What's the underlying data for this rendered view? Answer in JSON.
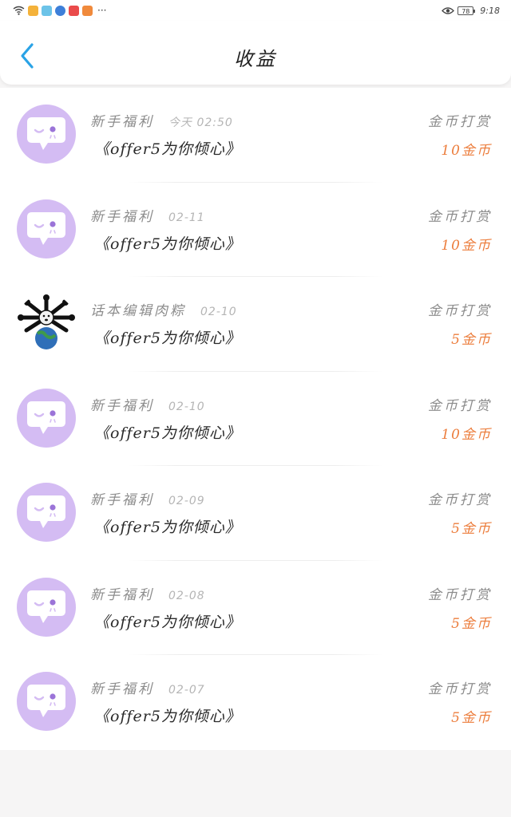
{
  "status_bar": {
    "time": "9:18",
    "battery": "78",
    "more": "···"
  },
  "header": {
    "title": "收益"
  },
  "colors": {
    "accent_blue": "#2aa3e6",
    "amount_orange": "#ec7d3c",
    "avatar_purple": "#d4bcf3"
  },
  "records": [
    {
      "sender": "新手福利",
      "date": "今天  02:50",
      "message": "《offer5为你倾心》",
      "reward_type": "金币打赏",
      "amount": "10金币",
      "avatar": "chat-bubble-icon"
    },
    {
      "sender": "新手福利",
      "date": "02-11",
      "message": "《offer5为你倾心》",
      "reward_type": "金币打赏",
      "amount": "10金币",
      "avatar": "chat-bubble-icon"
    },
    {
      "sender": "话本编辑肉粽",
      "date": "02-10",
      "message": "《offer5为你倾心》",
      "reward_type": "金币打赏",
      "amount": "5金币",
      "avatar": "custom-meme-avatar"
    },
    {
      "sender": "新手福利",
      "date": "02-10",
      "message": "《offer5为你倾心》",
      "reward_type": "金币打赏",
      "amount": "10金币",
      "avatar": "chat-bubble-icon"
    },
    {
      "sender": "新手福利",
      "date": "02-09",
      "message": "《offer5为你倾心》",
      "reward_type": "金币打赏",
      "amount": "5金币",
      "avatar": "chat-bubble-icon"
    },
    {
      "sender": "新手福利",
      "date": "02-08",
      "message": "《offer5为你倾心》",
      "reward_type": "金币打赏",
      "amount": "5金币",
      "avatar": "chat-bubble-icon"
    },
    {
      "sender": "新手福利",
      "date": "02-07",
      "message": "《offer5为你倾心》",
      "reward_type": "金币打赏",
      "amount": "5金币",
      "avatar": "chat-bubble-icon"
    }
  ]
}
